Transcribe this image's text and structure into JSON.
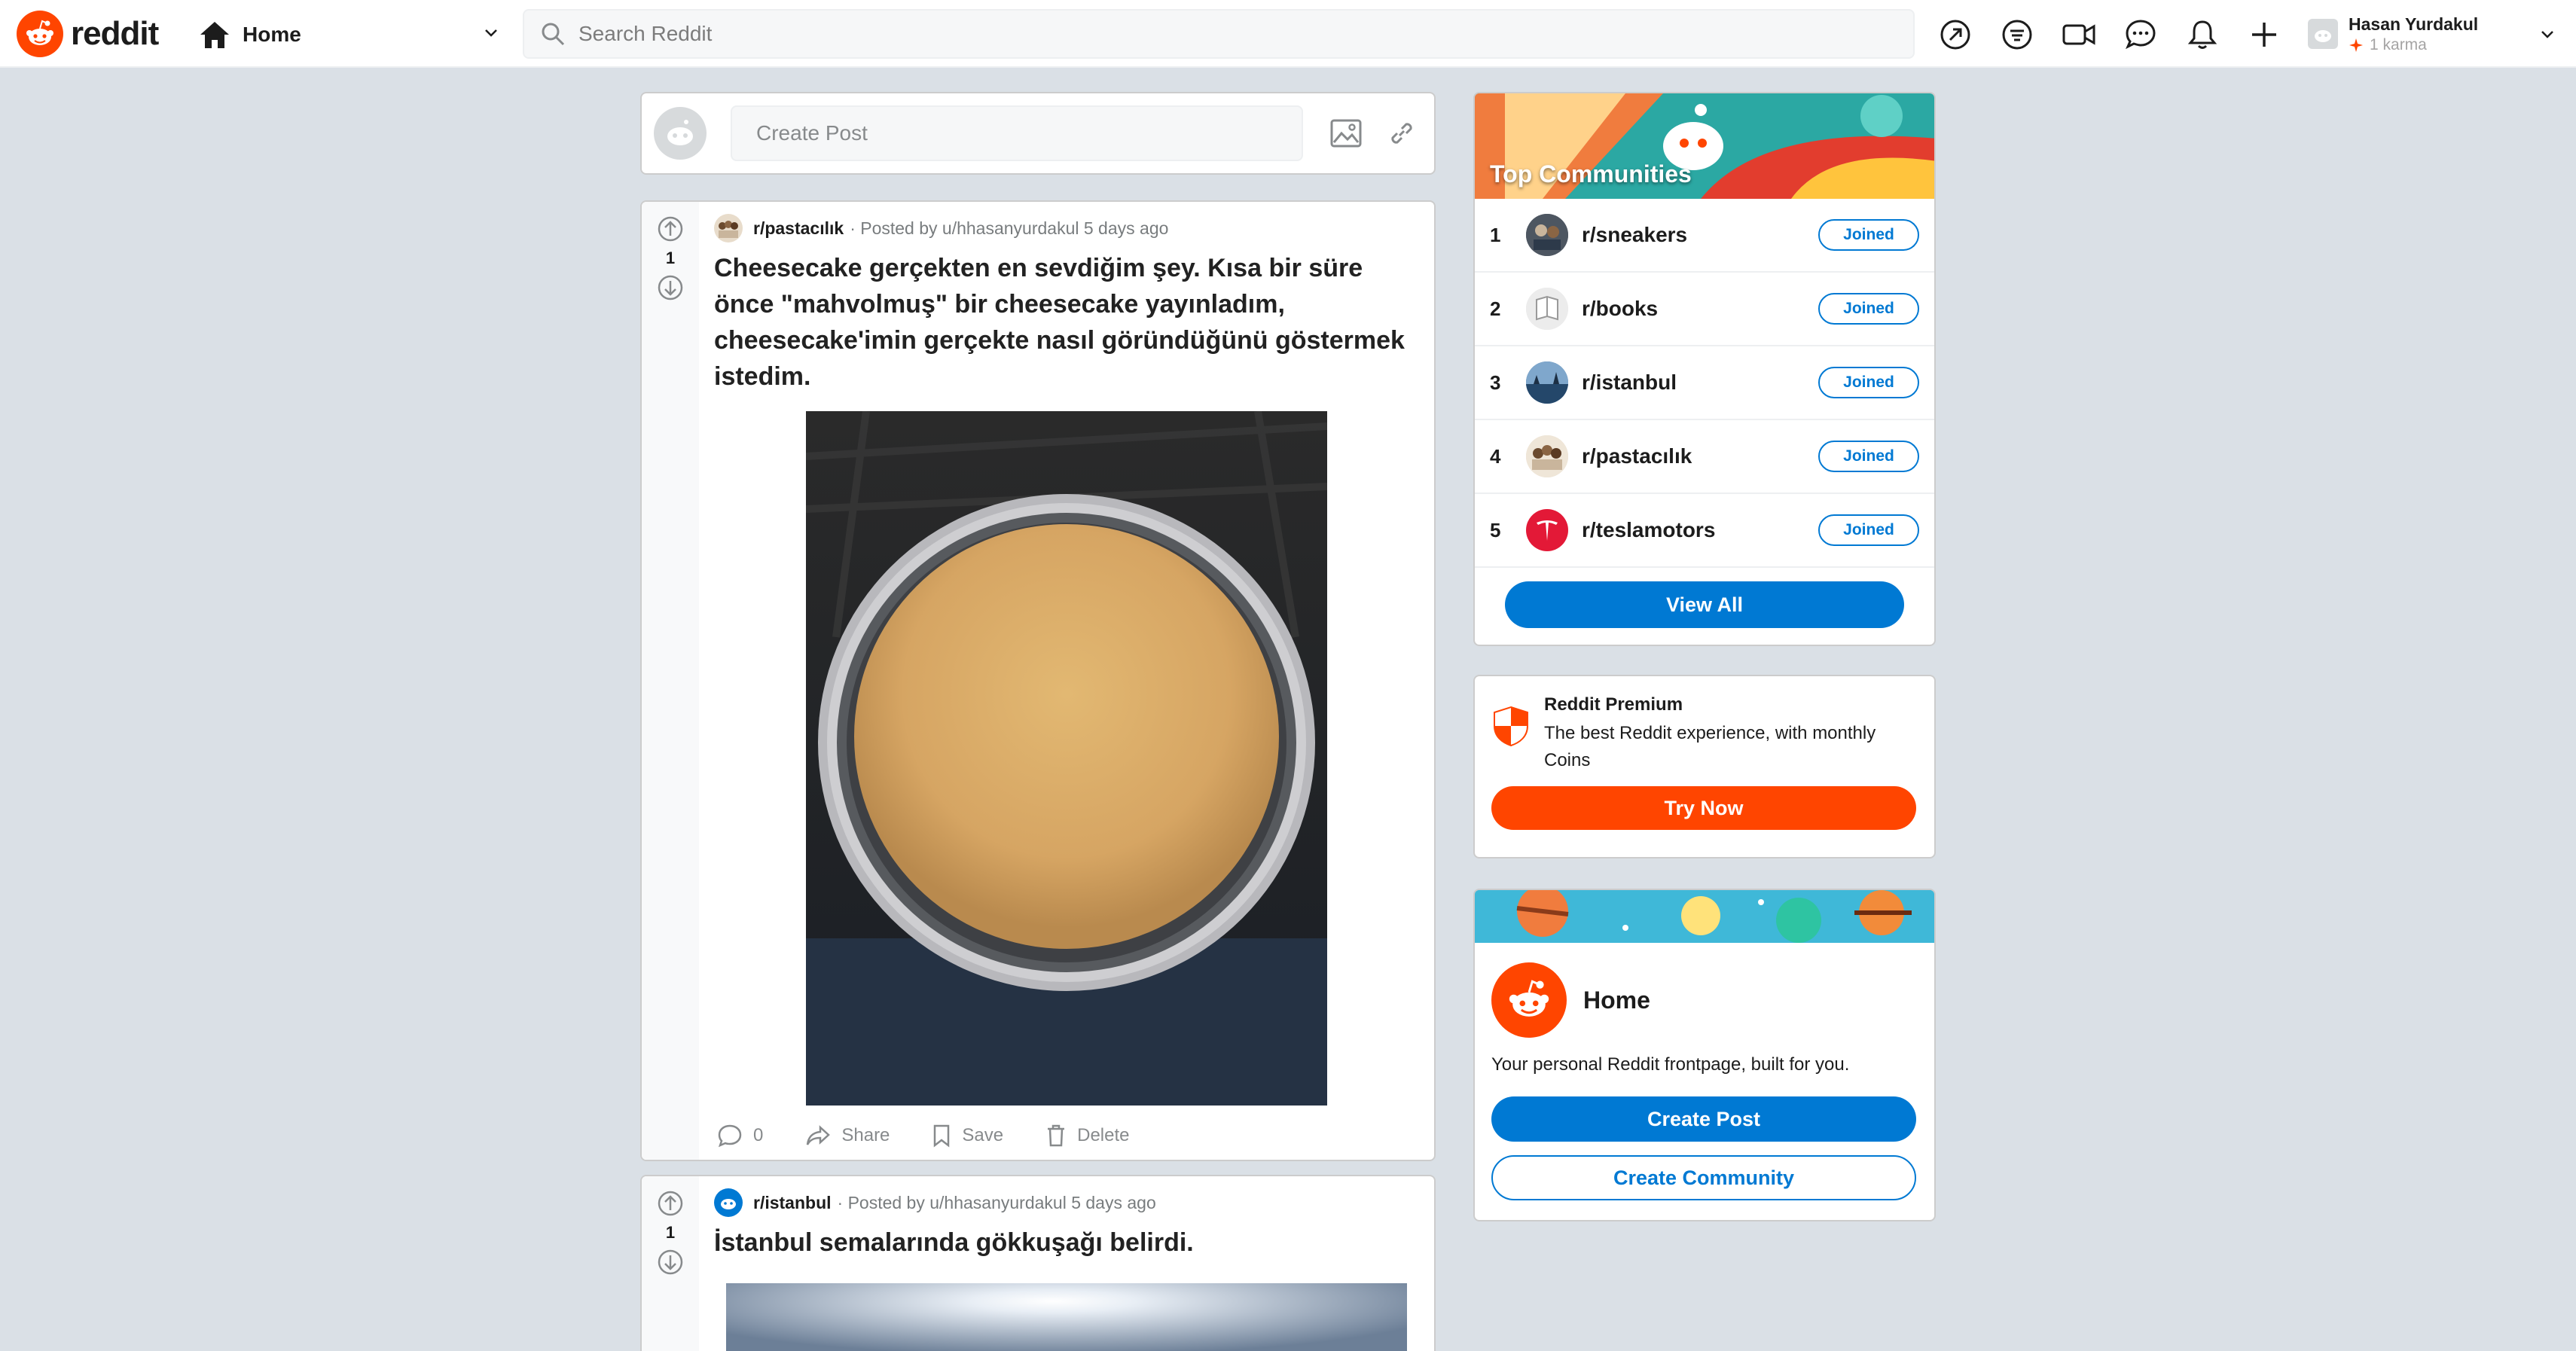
{
  "header": {
    "logo_text": "reddit",
    "feed_label": "Home",
    "search_placeholder": "Search Reddit",
    "user": {
      "name": "Hasan Yurdakul",
      "karma": "1 karma"
    }
  },
  "create_post": {
    "placeholder": "Create Post"
  },
  "posts": [
    {
      "subreddit": "r/pastacılık",
      "meta": "· Posted by u/hhasanyurdakul 5 days ago",
      "votes": "1",
      "title": "Cheesecake gerçekten en sevdiğim şey. Kısa bir süre önce \"mahvolmuş\" bir cheesecake yayınladım, cheesecake'imin gerçekte nasıl göründüğünü göstermek istedim.",
      "comments": "0",
      "share": "Share",
      "save": "Save",
      "delete": "Delete"
    },
    {
      "subreddit": "r/istanbul",
      "meta": "· Posted by u/hhasanyurdakul 5 days ago",
      "votes": "1",
      "title": "İstanbul semalarında gökkuşağı belirdi."
    }
  ],
  "top_communities": {
    "title": "Top Communities",
    "items": [
      {
        "rank": "1",
        "name": "r/sneakers",
        "status": "Joined"
      },
      {
        "rank": "2",
        "name": "r/books",
        "status": "Joined"
      },
      {
        "rank": "3",
        "name": "r/istanbul",
        "status": "Joined"
      },
      {
        "rank": "4",
        "name": "r/pastacılık",
        "status": "Joined"
      },
      {
        "rank": "5",
        "name": "r/teslamotors",
        "status": "Joined"
      }
    ],
    "view_all": "View All"
  },
  "premium": {
    "title": "Reddit Premium",
    "description": "The best Reddit experience, with monthly Coins",
    "cta": "Try Now"
  },
  "home_card": {
    "title": "Home",
    "description": "Your personal Reddit frontpage, built for you.",
    "create_post": "Create Post",
    "create_community": "Create Community"
  },
  "colors": {
    "brand": "#ff4500",
    "accent": "#0079d3",
    "background": "#dae0e6"
  }
}
